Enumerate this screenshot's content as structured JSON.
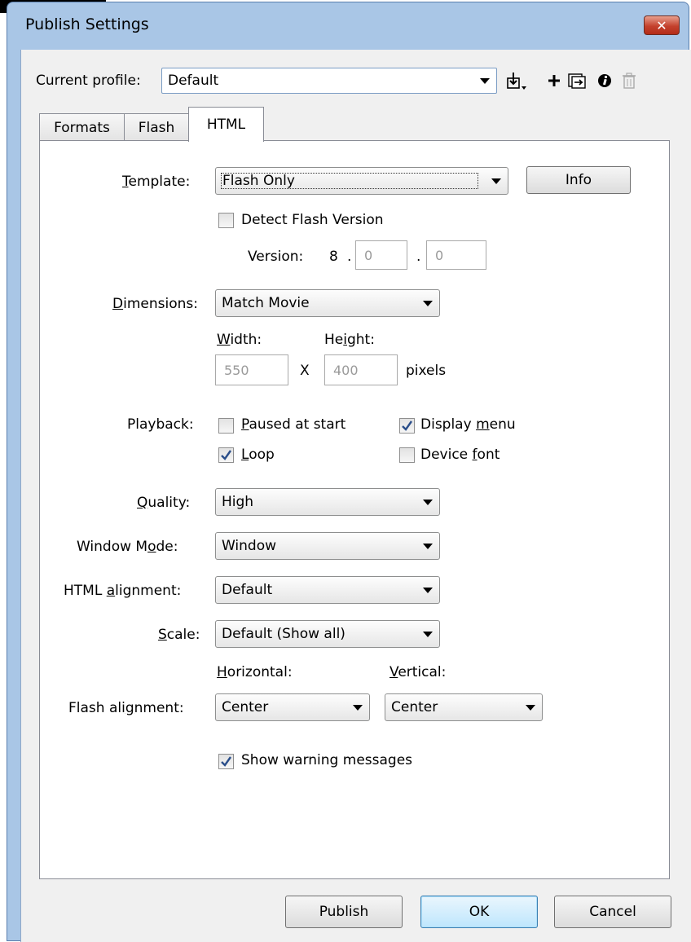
{
  "window": {
    "title": "Publish Settings",
    "close_glyph": "✕"
  },
  "profile": {
    "label": "Current profile:",
    "value": "Default",
    "toolbar_icons": [
      "import-export-icon",
      "plus-icon",
      "duplicate-icon",
      "info-icon",
      "trash-icon"
    ]
  },
  "tabs": [
    {
      "label": "Formats",
      "active": false
    },
    {
      "label": "Flash",
      "active": false
    },
    {
      "label": "HTML",
      "active": true
    }
  ],
  "template": {
    "label": "Template:",
    "value": "Flash Only",
    "info_button": "Info",
    "detect_label": "Detect Flash Version",
    "detect_checked": false,
    "version_label": "Version:",
    "version_major": "8",
    "version_sep": ".",
    "version_minor": "0",
    "version_revision": "0"
  },
  "dimensions": {
    "label": "Dimensions:",
    "value": "Match Movie",
    "width_label": "Width:",
    "height_label": "Height:",
    "width_value": "550",
    "height_value": "400",
    "times": "X",
    "unit": "pixels"
  },
  "playback": {
    "label": "Playback:",
    "paused": {
      "label": "Paused at start",
      "checked": false
    },
    "display_menu": {
      "label": "Display menu",
      "checked": true
    },
    "loop": {
      "label": "Loop",
      "checked": true
    },
    "device_font": {
      "label": "Device font",
      "checked": false
    }
  },
  "quality": {
    "label": "Quality:",
    "value": "High"
  },
  "window_mode": {
    "label": "Window Mode:",
    "value": "Window"
  },
  "html_alignment": {
    "label": "HTML alignment:",
    "value": "Default"
  },
  "scale": {
    "label": "Scale:",
    "value": "Default (Show all)"
  },
  "flash_alignment": {
    "label": "Flash alignment:",
    "horizontal_label": "Horizontal:",
    "vertical_label": "Vertical:",
    "horizontal_value": "Center",
    "vertical_value": "Center"
  },
  "warnings": {
    "label": "Show warning messages",
    "checked": true
  },
  "buttons": {
    "publish": "Publish",
    "ok": "OK",
    "cancel": "Cancel"
  },
  "colors": {
    "accent": "#3c7fb1",
    "title_bar": "#a9c6e6",
    "close": "#c4412d"
  }
}
